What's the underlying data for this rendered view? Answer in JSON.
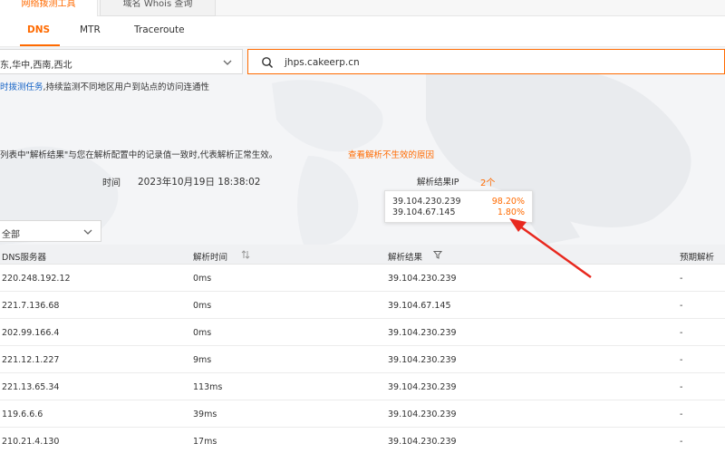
{
  "top_tabs": {
    "active": "网络拨测工具",
    "inactive": "域名 Whois 查询"
  },
  "sub_tabs": [
    "DNS",
    "MTR",
    "Traceroute"
  ],
  "query": {
    "region_value": "东,华中,西南,西北",
    "domain_value": "jhps.cakeerp.cn"
  },
  "hint": {
    "link": "时拨测任务",
    "text": ",持续监测不同地区用户到站点的访问连通性"
  },
  "notice": {
    "text": "列表中\"解析结果\"与您在解析配置中的记录值一致时,代表解析正常生效。",
    "link": "查看解析不生效的原因"
  },
  "summary": {
    "time_label": "时间",
    "time_value": "2023年10月19日 18:38:02",
    "ip_label": "解析结果IP",
    "ip_count": "2个"
  },
  "ip_popover": [
    {
      "ip": "39.104.230.239",
      "pct": "98.20%"
    },
    {
      "ip": "39.104.67.145",
      "pct": "1.80%"
    }
  ],
  "filter": {
    "value": "全部"
  },
  "table": {
    "headers": [
      "DNS服务器",
      "解析时间",
      "解析结果",
      "预期解析"
    ],
    "rows": [
      {
        "server": "220.248.192.12",
        "time": "0ms",
        "result": "39.104.230.239",
        "expected": "-"
      },
      {
        "server": "221.7.136.68",
        "time": "0ms",
        "result": "39.104.67.145",
        "expected": "-"
      },
      {
        "server": "202.99.166.4",
        "time": "0ms",
        "result": "39.104.230.239",
        "expected": "-"
      },
      {
        "server": "221.12.1.227",
        "time": "9ms",
        "result": "39.104.230.239",
        "expected": "-"
      },
      {
        "server": "221.13.65.34",
        "time": "113ms",
        "result": "39.104.230.239",
        "expected": "-"
      },
      {
        "server": "119.6.6.6",
        "time": "39ms",
        "result": "39.104.230.239",
        "expected": "-"
      },
      {
        "server": "210.21.4.130",
        "time": "17ms",
        "result": "39.104.230.239",
        "expected": "-"
      }
    ]
  },
  "colors": {
    "accent": "#ff6a00",
    "link": "#1a66c7",
    "annotation_arrow": "#e8281e"
  }
}
